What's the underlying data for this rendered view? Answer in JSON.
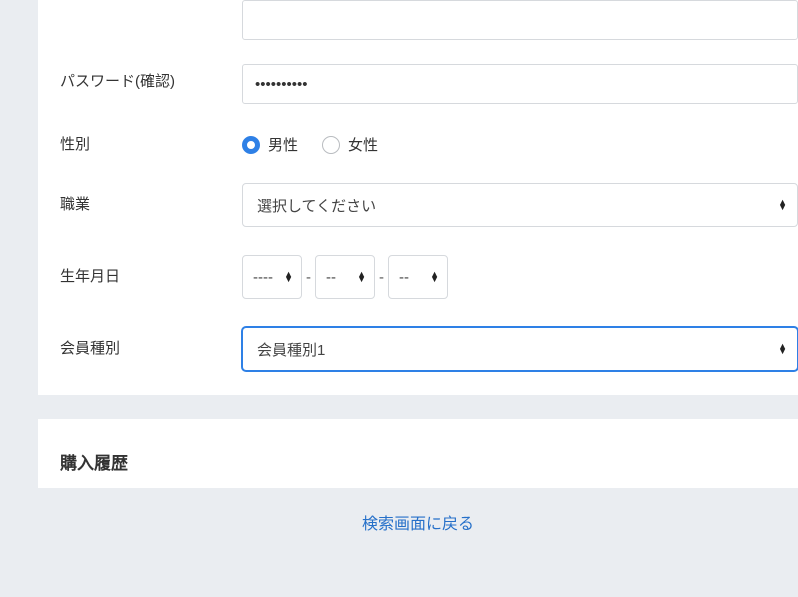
{
  "form": {
    "password_confirm": {
      "label": "パスワード(確認)",
      "value": "••••••••••"
    },
    "gender": {
      "label": "性別",
      "options": {
        "male": "男性",
        "female": "女性"
      },
      "selected": "male"
    },
    "occupation": {
      "label": "職業",
      "placeholder": "選択してください"
    },
    "birthday": {
      "label": "生年月日",
      "year": "----",
      "month": "--",
      "day": "--"
    },
    "member_type": {
      "label": "会員種別",
      "value": "会員種別1"
    }
  },
  "sections": {
    "purchase_history": "購入履歴"
  },
  "footer": {
    "back_link": "検索画面に戻る"
  }
}
